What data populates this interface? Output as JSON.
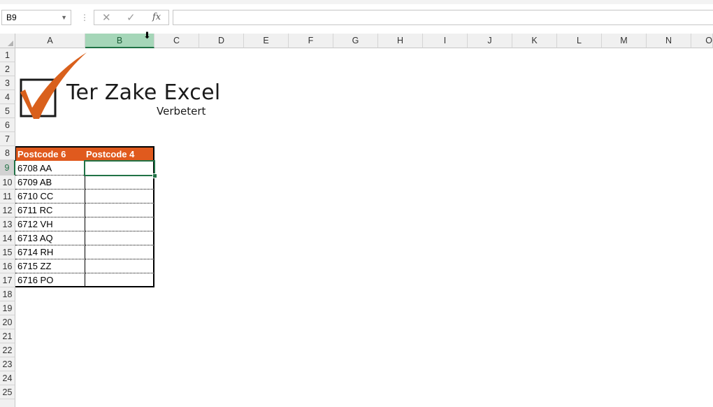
{
  "formula_bar": {
    "name_box": "B9",
    "separator": "⋮",
    "cancel_icon": "✕",
    "enter_icon": "✓",
    "fx_label": "fx",
    "formula": ""
  },
  "columns": [
    "A",
    "B",
    "C",
    "D",
    "E",
    "F",
    "G",
    "H",
    "I",
    "J",
    "K",
    "L",
    "M",
    "N",
    "O"
  ],
  "selected_column": "B",
  "rows": [
    "1",
    "2",
    "3",
    "4",
    "5",
    "6",
    "7",
    "8",
    "9",
    "10",
    "11",
    "12",
    "13",
    "14",
    "15",
    "16",
    "17",
    "18",
    "19",
    "20",
    "21",
    "22",
    "23",
    "24",
    "25"
  ],
  "selected_row": "9",
  "logo": {
    "title": "Ter Zake Excel",
    "subtitle": "Verbetert",
    "check_color": "#d9601c"
  },
  "table": {
    "headers": [
      "Postcode 6",
      "Postcode 4"
    ],
    "header_color": "#e05a1e",
    "rows": [
      [
        "6708 AA",
        ""
      ],
      [
        "6709 AB",
        ""
      ],
      [
        "6710 CC",
        ""
      ],
      [
        "6711 RC",
        ""
      ],
      [
        "6712 VH",
        ""
      ],
      [
        "6713 AQ",
        ""
      ],
      [
        "6714 RH",
        ""
      ],
      [
        "6715 ZZ",
        ""
      ],
      [
        "6716 PO",
        ""
      ]
    ]
  }
}
